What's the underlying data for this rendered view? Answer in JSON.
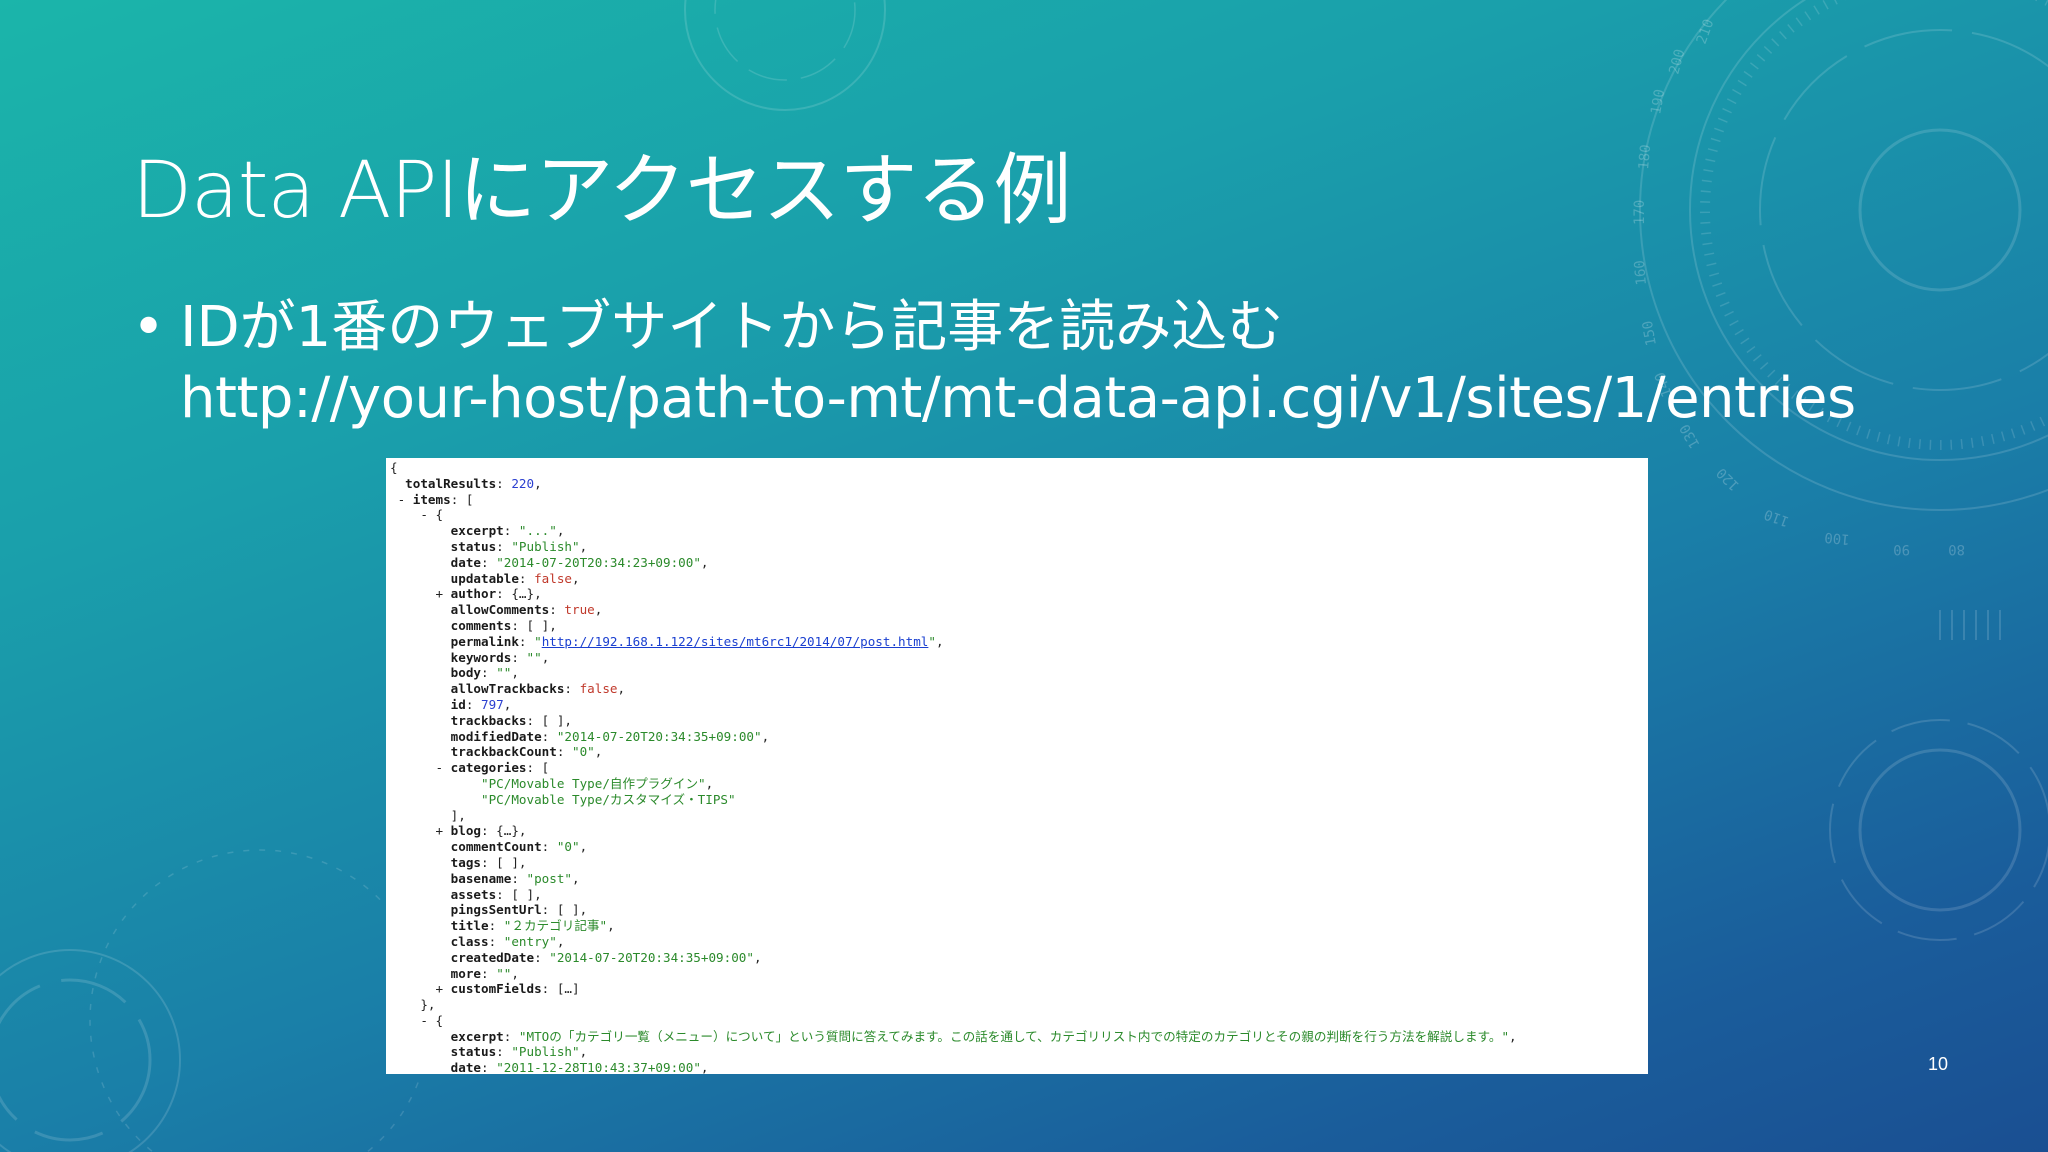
{
  "slide": {
    "title": "Data APIにアクセスする例",
    "bullet": "IDが1番のウェブサイトから記事を読み込む",
    "url": "http://your-host/path-to-mt/mt-data-api.cgi/v1/sites/1/entries",
    "page_number": "10"
  },
  "dial_labels": [
    "210",
    "200",
    "190",
    "180",
    "170",
    "160",
    "150",
    "140",
    "130",
    "120",
    "110",
    "100",
    "90",
    "80"
  ],
  "colors": {
    "background_top": "#1bb5aa",
    "background_bottom": "#1a4f92",
    "json_key": "#1a1a1a",
    "json_string": "#2b8a2b",
    "json_number": "#2b3fd0",
    "json_boolean": "#c0392b"
  },
  "code_lines": [
    {
      "indent": 0,
      "parts": [
        {
          "t": "p",
          "v": "{"
        }
      ]
    },
    {
      "indent": 2,
      "parts": [
        {
          "t": "k",
          "v": "totalResults"
        },
        {
          "t": "p",
          "v": ": "
        },
        {
          "t": "n",
          "v": "220"
        },
        {
          "t": "p",
          "v": ","
        }
      ]
    },
    {
      "indent": 1,
      "parts": [
        {
          "t": "p",
          "v": "- "
        },
        {
          "t": "k",
          "v": "items"
        },
        {
          "t": "p",
          "v": ": ["
        }
      ]
    },
    {
      "indent": 4,
      "parts": [
        {
          "t": "p",
          "v": "- {"
        }
      ]
    },
    {
      "indent": 8,
      "parts": [
        {
          "t": "k",
          "v": "excerpt"
        },
        {
          "t": "p",
          "v": ": "
        },
        {
          "t": "s",
          "v": "\"...\""
        },
        {
          "t": "p",
          "v": ","
        }
      ]
    },
    {
      "indent": 8,
      "parts": [
        {
          "t": "k",
          "v": "status"
        },
        {
          "t": "p",
          "v": ": "
        },
        {
          "t": "s",
          "v": "\"Publish\""
        },
        {
          "t": "p",
          "v": ","
        }
      ]
    },
    {
      "indent": 8,
      "parts": [
        {
          "t": "k",
          "v": "date"
        },
        {
          "t": "p",
          "v": ": "
        },
        {
          "t": "s",
          "v": "\"2014-07-20T20:34:23+09:00\""
        },
        {
          "t": "p",
          "v": ","
        }
      ]
    },
    {
      "indent": 8,
      "parts": [
        {
          "t": "k",
          "v": "updatable"
        },
        {
          "t": "p",
          "v": ": "
        },
        {
          "t": "b",
          "v": "false"
        },
        {
          "t": "p",
          "v": ","
        }
      ]
    },
    {
      "indent": 6,
      "parts": [
        {
          "t": "p",
          "v": "+ "
        },
        {
          "t": "k",
          "v": "author"
        },
        {
          "t": "p",
          "v": ": {…},"
        }
      ]
    },
    {
      "indent": 8,
      "parts": [
        {
          "t": "k",
          "v": "allowComments"
        },
        {
          "t": "p",
          "v": ": "
        },
        {
          "t": "b",
          "v": "true"
        },
        {
          "t": "p",
          "v": ","
        }
      ]
    },
    {
      "indent": 8,
      "parts": [
        {
          "t": "k",
          "v": "comments"
        },
        {
          "t": "p",
          "v": ": [ ],"
        }
      ]
    },
    {
      "indent": 8,
      "parts": [
        {
          "t": "k",
          "v": "permalink"
        },
        {
          "t": "p",
          "v": ": "
        },
        {
          "t": "s",
          "v": "\""
        },
        {
          "t": "u",
          "v": "http://192.168.1.122/sites/mt6rc1/2014/07/post.html"
        },
        {
          "t": "s",
          "v": "\""
        },
        {
          "t": "p",
          "v": ","
        }
      ]
    },
    {
      "indent": 8,
      "parts": [
        {
          "t": "k",
          "v": "keywords"
        },
        {
          "t": "p",
          "v": ": "
        },
        {
          "t": "s",
          "v": "\"\""
        },
        {
          "t": "p",
          "v": ","
        }
      ]
    },
    {
      "indent": 8,
      "parts": [
        {
          "t": "k",
          "v": "body"
        },
        {
          "t": "p",
          "v": ": "
        },
        {
          "t": "s",
          "v": "\"\""
        },
        {
          "t": "p",
          "v": ","
        }
      ]
    },
    {
      "indent": 8,
      "parts": [
        {
          "t": "k",
          "v": "allowTrackbacks"
        },
        {
          "t": "p",
          "v": ": "
        },
        {
          "t": "b",
          "v": "false"
        },
        {
          "t": "p",
          "v": ","
        }
      ]
    },
    {
      "indent": 8,
      "parts": [
        {
          "t": "k",
          "v": "id"
        },
        {
          "t": "p",
          "v": ": "
        },
        {
          "t": "n",
          "v": "797"
        },
        {
          "t": "p",
          "v": ","
        }
      ]
    },
    {
      "indent": 8,
      "parts": [
        {
          "t": "k",
          "v": "trackbacks"
        },
        {
          "t": "p",
          "v": ": [ ],"
        }
      ]
    },
    {
      "indent": 8,
      "parts": [
        {
          "t": "k",
          "v": "modifiedDate"
        },
        {
          "t": "p",
          "v": ": "
        },
        {
          "t": "s",
          "v": "\"2014-07-20T20:34:35+09:00\""
        },
        {
          "t": "p",
          "v": ","
        }
      ]
    },
    {
      "indent": 8,
      "parts": [
        {
          "t": "k",
          "v": "trackbackCount"
        },
        {
          "t": "p",
          "v": ": "
        },
        {
          "t": "s",
          "v": "\"0\""
        },
        {
          "t": "p",
          "v": ","
        }
      ]
    },
    {
      "indent": 6,
      "parts": [
        {
          "t": "p",
          "v": "- "
        },
        {
          "t": "k",
          "v": "categories"
        },
        {
          "t": "p",
          "v": ": ["
        }
      ]
    },
    {
      "indent": 12,
      "parts": [
        {
          "t": "s",
          "v": "\"PC/Movable Type/自作プラグイン\""
        },
        {
          "t": "p",
          "v": ","
        }
      ]
    },
    {
      "indent": 12,
      "parts": [
        {
          "t": "s",
          "v": "\"PC/Movable Type/カスタマイズ・TIPS\""
        }
      ]
    },
    {
      "indent": 8,
      "parts": [
        {
          "t": "p",
          "v": "],"
        }
      ]
    },
    {
      "indent": 6,
      "parts": [
        {
          "t": "p",
          "v": "+ "
        },
        {
          "t": "k",
          "v": "blog"
        },
        {
          "t": "p",
          "v": ": {…},"
        }
      ]
    },
    {
      "indent": 8,
      "parts": [
        {
          "t": "k",
          "v": "commentCount"
        },
        {
          "t": "p",
          "v": ": "
        },
        {
          "t": "s",
          "v": "\"0\""
        },
        {
          "t": "p",
          "v": ","
        }
      ]
    },
    {
      "indent": 8,
      "parts": [
        {
          "t": "k",
          "v": "tags"
        },
        {
          "t": "p",
          "v": ": [ ],"
        }
      ]
    },
    {
      "indent": 8,
      "parts": [
        {
          "t": "k",
          "v": "basename"
        },
        {
          "t": "p",
          "v": ": "
        },
        {
          "t": "s",
          "v": "\"post\""
        },
        {
          "t": "p",
          "v": ","
        }
      ]
    },
    {
      "indent": 8,
      "parts": [
        {
          "t": "k",
          "v": "assets"
        },
        {
          "t": "p",
          "v": ": [ ],"
        }
      ]
    },
    {
      "indent": 8,
      "parts": [
        {
          "t": "k",
          "v": "pingsSentUrl"
        },
        {
          "t": "p",
          "v": ": [ ],"
        }
      ]
    },
    {
      "indent": 8,
      "parts": [
        {
          "t": "k",
          "v": "title"
        },
        {
          "t": "p",
          "v": ": "
        },
        {
          "t": "s",
          "v": "\"２カテゴリ記事\""
        },
        {
          "t": "p",
          "v": ","
        }
      ]
    },
    {
      "indent": 8,
      "parts": [
        {
          "t": "k",
          "v": "class"
        },
        {
          "t": "p",
          "v": ": "
        },
        {
          "t": "s",
          "v": "\"entry\""
        },
        {
          "t": "p",
          "v": ","
        }
      ]
    },
    {
      "indent": 8,
      "parts": [
        {
          "t": "k",
          "v": "createdDate"
        },
        {
          "t": "p",
          "v": ": "
        },
        {
          "t": "s",
          "v": "\"2014-07-20T20:34:35+09:00\""
        },
        {
          "t": "p",
          "v": ","
        }
      ]
    },
    {
      "indent": 8,
      "parts": [
        {
          "t": "k",
          "v": "more"
        },
        {
          "t": "p",
          "v": ": "
        },
        {
          "t": "s",
          "v": "\"\""
        },
        {
          "t": "p",
          "v": ","
        }
      ]
    },
    {
      "indent": 6,
      "parts": [
        {
          "t": "p",
          "v": "+ "
        },
        {
          "t": "k",
          "v": "customFields"
        },
        {
          "t": "p",
          "v": ": […]"
        }
      ]
    },
    {
      "indent": 4,
      "parts": [
        {
          "t": "p",
          "v": "},"
        }
      ]
    },
    {
      "indent": 4,
      "parts": [
        {
          "t": "p",
          "v": "- {"
        }
      ]
    },
    {
      "indent": 8,
      "parts": [
        {
          "t": "k",
          "v": "excerpt"
        },
        {
          "t": "p",
          "v": ": "
        },
        {
          "t": "s",
          "v": "\"MTOの「カテゴリ一覧（メニュー）について」という質問に答えてみます。この話を通して、カテゴリリスト内での特定のカテゴリとその親の判断を行う方法を解説します。\""
        },
        {
          "t": "p",
          "v": ","
        }
      ]
    },
    {
      "indent": 8,
      "parts": [
        {
          "t": "k",
          "v": "status"
        },
        {
          "t": "p",
          "v": ": "
        },
        {
          "t": "s",
          "v": "\"Publish\""
        },
        {
          "t": "p",
          "v": ","
        }
      ]
    },
    {
      "indent": 8,
      "parts": [
        {
          "t": "k",
          "v": "date"
        },
        {
          "t": "p",
          "v": ": "
        },
        {
          "t": "s",
          "v": "\"2011-12-28T10:43:37+09:00\""
        },
        {
          "t": "p",
          "v": ","
        }
      ]
    }
  ]
}
